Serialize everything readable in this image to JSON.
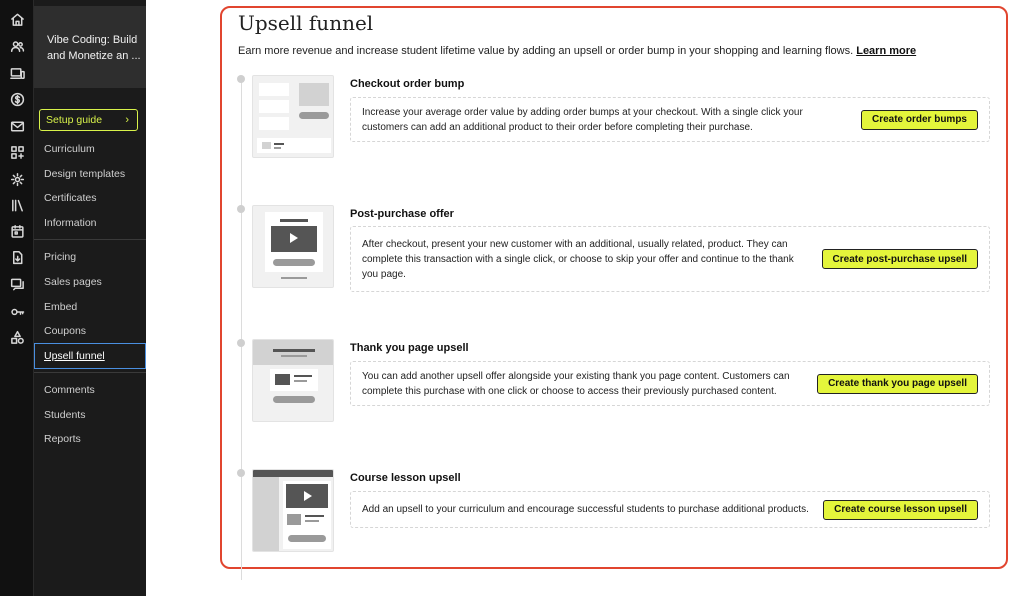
{
  "rail": {
    "icons": [
      "home-icon",
      "users-icon",
      "devices-icon",
      "dollar-icon",
      "mail-icon",
      "apps-icon",
      "settings-icon",
      "library-icon",
      "calendar-icon",
      "download-icon",
      "chat-icon",
      "key-icon",
      "shapes-icon"
    ]
  },
  "course": {
    "title": "Vibe Coding: Build and Monetize an ..."
  },
  "nav": {
    "setup_label": "Setup guide",
    "setup_chevron": "›",
    "group1": [
      "Curriculum",
      "Design templates",
      "Certificates",
      "Information"
    ],
    "group2": [
      "Pricing",
      "Sales pages",
      "Embed",
      "Coupons",
      "Upsell funnel"
    ],
    "group3": [
      "Comments",
      "Students",
      "Reports"
    ],
    "active": "Upsell funnel"
  },
  "page": {
    "title": "Upsell funnel",
    "subtitle": "Earn more revenue and increase student lifetime value by adding an upsell or order bump in your shopping and learning flows.",
    "learn_more": "Learn more"
  },
  "steps": [
    {
      "title": "Checkout order bump",
      "description": "Increase your average order value by adding order bumps at your checkout. With a single click your customers can add an additional product to their order before completing their purchase.",
      "button": "Create order bumps"
    },
    {
      "title": "Post-purchase offer",
      "description": "After checkout, present your new customer with an additional, usually related, product. They can complete this transaction with a single click, or choose to skip your offer and continue to the thank you page.",
      "button": "Create post-purchase upsell"
    },
    {
      "title": "Thank you page upsell",
      "description": "You can add another upsell offer alongside your existing thank you page content. Customers can complete this purchase with one click or choose to access their previously purchased content.",
      "button": "Create thank you page upsell"
    },
    {
      "title": "Course lesson upsell",
      "description": "Add an upsell to your curriculum and encourage successful students to purchase additional products.",
      "button": "Create course lesson upsell"
    }
  ],
  "colors": {
    "accent": "#e4f53b",
    "highlight": "#e1452f",
    "active_outline": "#4a8fe0",
    "sidebar": "#1b1b1b"
  }
}
